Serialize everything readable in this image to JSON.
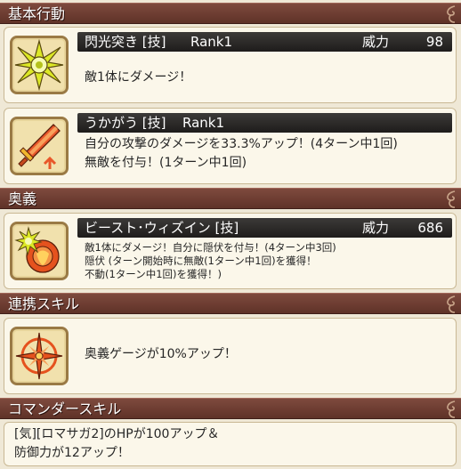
{
  "sections": {
    "basic": "基本行動",
    "ougi": "奥義",
    "renkei": "連携スキル",
    "commander": "コマンダースキル"
  },
  "skills": [
    {
      "name": "閃光突き [技]",
      "rank": "Rank1",
      "power_label": "威力",
      "power": "98",
      "desc": [
        "敵1体にダメージ！"
      ],
      "icon": "burst-star-icon"
    },
    {
      "name": "うかがう [技]",
      "rank": "Rank1",
      "desc": [
        "自分の攻撃のダメージを33.3%アップ！(4ターン中1回)",
        "無敵を付与！(1ターン中1回)"
      ],
      "icon": "sword-up-icon"
    }
  ],
  "ougi": {
    "name": "ビースト･ウィズイン [技]",
    "power_label": "威力",
    "power": "686",
    "desc": [
      "敵1体にダメージ！自分に隠伏を付与！(4ターン中3回)",
      "隠伏 (ターン開始時に無敵(1ターン中1回)を獲得！",
      "不動(1ターン中1回)を獲得！)"
    ],
    "icon": "star-shield-icon"
  },
  "renkei": {
    "desc": [
      "奥義ゲージが10%アップ！"
    ],
    "icon": "compass-star-icon"
  },
  "commander": {
    "desc": [
      "[気][ロマサガ2]のHPが100アップ＆",
      "防御力が12アップ！"
    ]
  },
  "colors": {
    "header": "#6b3a2f",
    "card_bg": "#fbf7ea",
    "skill_bar": "#2a2827",
    "icon_frame": "#9a7a45"
  }
}
